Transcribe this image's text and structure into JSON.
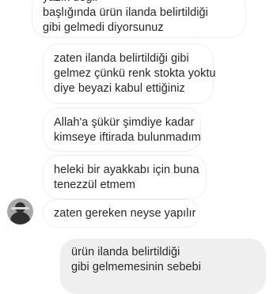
{
  "messages": [
    {
      "direction": "in",
      "lines": [
        "başlığında ürün ilanda belirtildiği",
        "gibi gelmedi diyorsunuz"
      ]
    },
    {
      "direction": "in",
      "lines": [
        "zaten ilanda belirtildiği gibi",
        "gelmez çünkü renk stokta yoktu",
        "diye beyazi kabul ettiğiniz"
      ]
    },
    {
      "direction": "in",
      "lines": [
        "Allah'a şükür şimdiye kadar",
        "kimseye iftirada bulunmadım"
      ]
    },
    {
      "direction": "in",
      "lines": [
        "heleki bir ayakkabı için buna",
        "tenezzül etmem"
      ]
    },
    {
      "direction": "in",
      "lines": [
        "zaten gereken neyse yapılır"
      ]
    },
    {
      "direction": "out",
      "lines": [
        "ürün ilanda belirtildiği",
        "gibi gelmemesinin sebebi"
      ]
    }
  ],
  "sender_avatar": {
    "icon": "user-avatar-icon"
  },
  "colors": {
    "incoming_border": "#efefef",
    "outgoing_bg": "#efefef",
    "text": "#262626"
  }
}
